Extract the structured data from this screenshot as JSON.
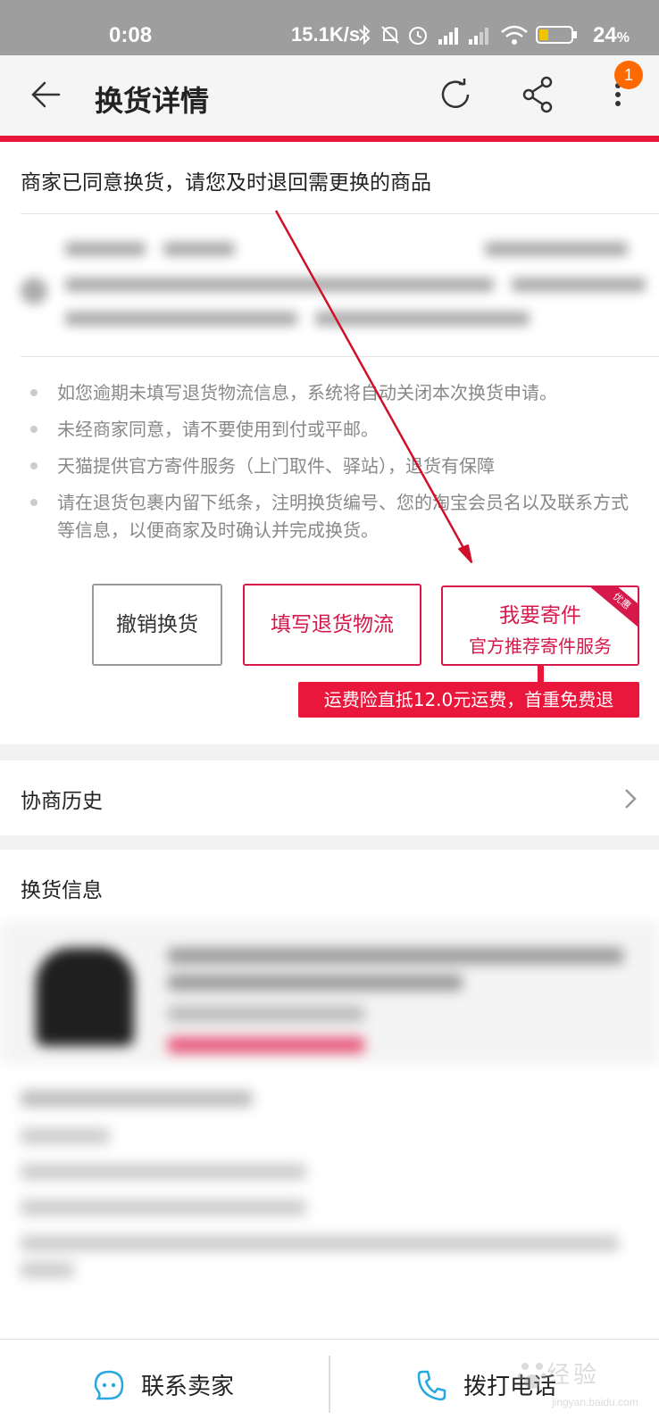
{
  "status_bar": {
    "time": "0:08",
    "net_speed": "15.1K/s",
    "battery": "24",
    "battery_unit": "%"
  },
  "header": {
    "title": "换货详情",
    "notification_count": "1",
    "back_icon": "back-arrow-icon",
    "refresh_icon": "refresh-icon",
    "share_icon": "share-icon",
    "more_icon": "more-vertical-icon"
  },
  "status": {
    "headline": "商家已同意换货，请您及时退回需更换的商品"
  },
  "notes": [
    "如您逾期未填写退货物流信息，系统将自动关闭本次换货申请。",
    "未经商家同意，请不要使用到付或平邮。",
    "天猫提供官方寄件服务（上门取件、驿站），退货有保障",
    "请在退货包裹内留下纸条，注明换货编号、您的淘宝会员名以及联系方式等信息，以便商家及时确认并完成换货。"
  ],
  "actions": {
    "cancel_label": "撤销换货",
    "fill_logistics_label": "填写退货物流",
    "ship_label": "我要寄件",
    "ship_sub_label": "官方推荐寄件服务",
    "ship_ribbon": "优惠",
    "ship_tip": "运费险直抵12.0元运费，首重免费退"
  },
  "history": {
    "label": "协商历史"
  },
  "exchange_info": {
    "label": "换货信息"
  },
  "bottom": {
    "contact_seller_label": "联系卖家",
    "call_label": "拨打电话"
  },
  "watermark": {
    "text": "经验",
    "site": "jingyan.baidu.com"
  },
  "colors": {
    "accent": "#e8173b",
    "button_red": "#d6194a",
    "badge": "#ff6a00",
    "status_bar": "#9e9e9e"
  }
}
